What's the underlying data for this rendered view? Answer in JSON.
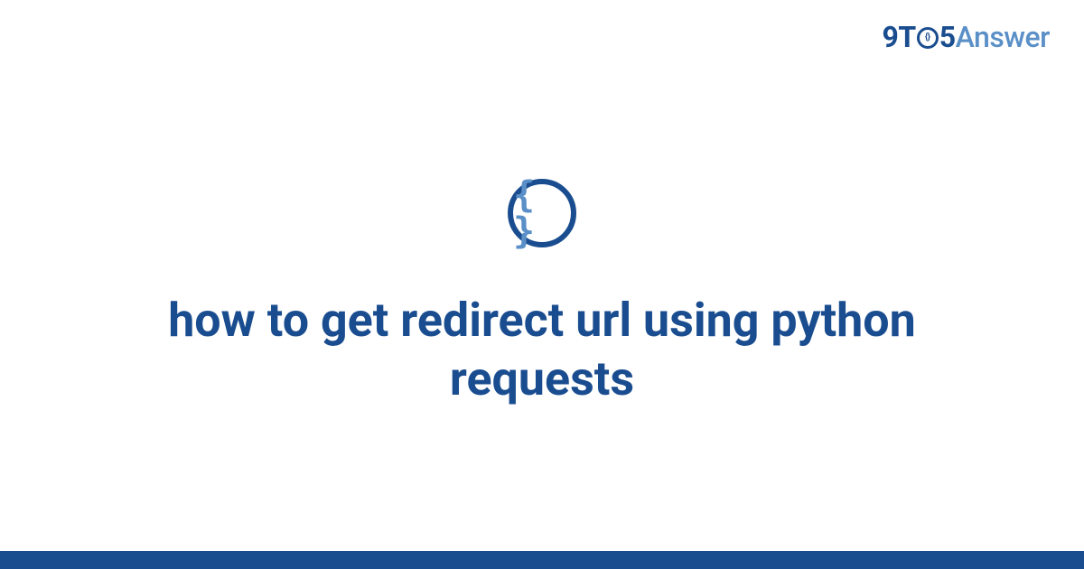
{
  "logo": {
    "part1": "9T",
    "part2_inner": "{}",
    "part3": "5",
    "part4": "Answer"
  },
  "icon": {
    "braces": "{ }"
  },
  "title": "how to get redirect url using python requests",
  "colors": {
    "primary": "#1a4d8f",
    "secondary": "#5a8fc7"
  }
}
